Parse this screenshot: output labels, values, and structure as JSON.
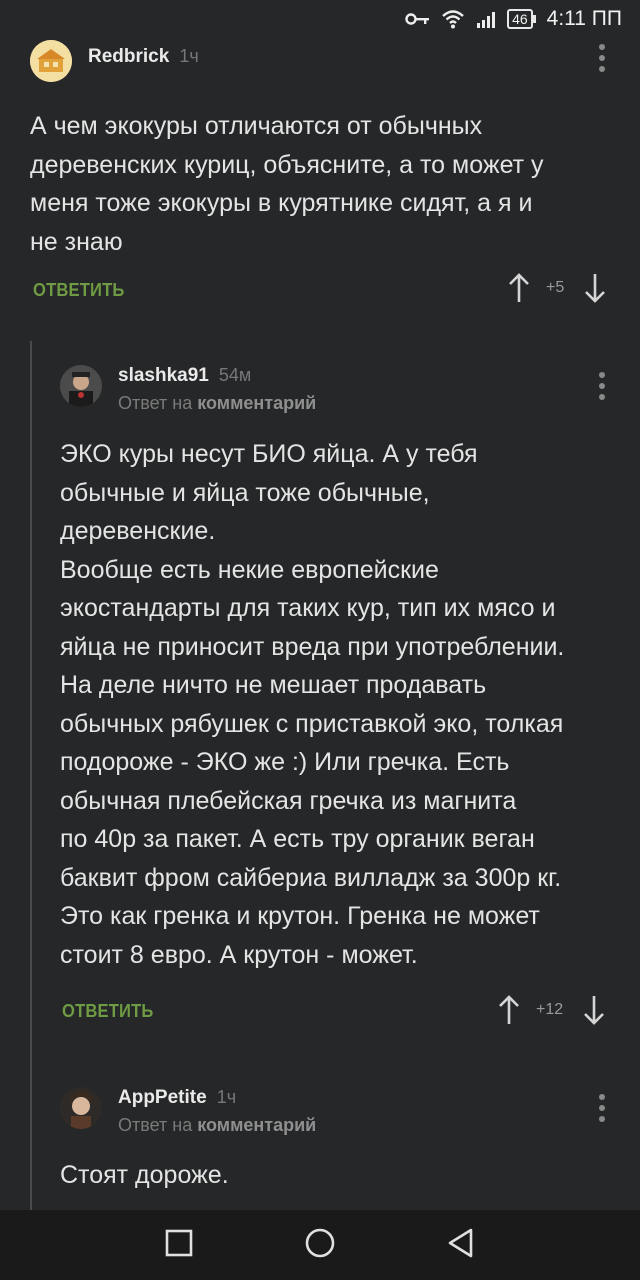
{
  "status_bar": {
    "network": "46",
    "time": "4:11 ПП"
  },
  "comments": [
    {
      "author": "Redbrick",
      "time": "1ч",
      "text": "А чем экокуры отличаются от обычных\nдеревенских куриц, объясните, а то может у\nменя тоже экокуры в курятнике сидят, а я и\nне знаю",
      "reply_label": "ОТВЕТИТЬ",
      "score": "+5"
    },
    {
      "author": "slashka91",
      "time": "54м",
      "reply_prefix": "Ответ на",
      "reply_target": "комментарий",
      "text": "ЭКО куры несут БИО яйца. А у тебя\nобычные и яйца тоже обычные,\nдеревенские.\nВообще есть некие европейские\nэкостандарты для таких кур, тип их мясо и\nяйца не приносит вреда при употреблении.\nНа деле ничто не мешает продавать\nобычных рябушек с приставкой эко, толкая\nподороже - ЭКО же :) Или гречка. Есть\nобычная плебейская гречка из магнита\nпо 40р за пакет. А есть тру органик веган\nбаквит фром сайбериа вилладж за 300р кг.\nЭто как гренка и крутон. Гренка не может\nстоит 8 евро. А крутон - может.",
      "reply_label": "ОТВЕТИТЬ",
      "score": "+12"
    },
    {
      "author": "AppPetite",
      "time": "1ч",
      "reply_prefix": "Ответ на",
      "reply_target": "комментарий",
      "text": "Стоят дороже."
    }
  ],
  "colors": {
    "background": "#262728",
    "reply_green": "#6e9b43",
    "nav_bar": "#1a1a1a"
  }
}
